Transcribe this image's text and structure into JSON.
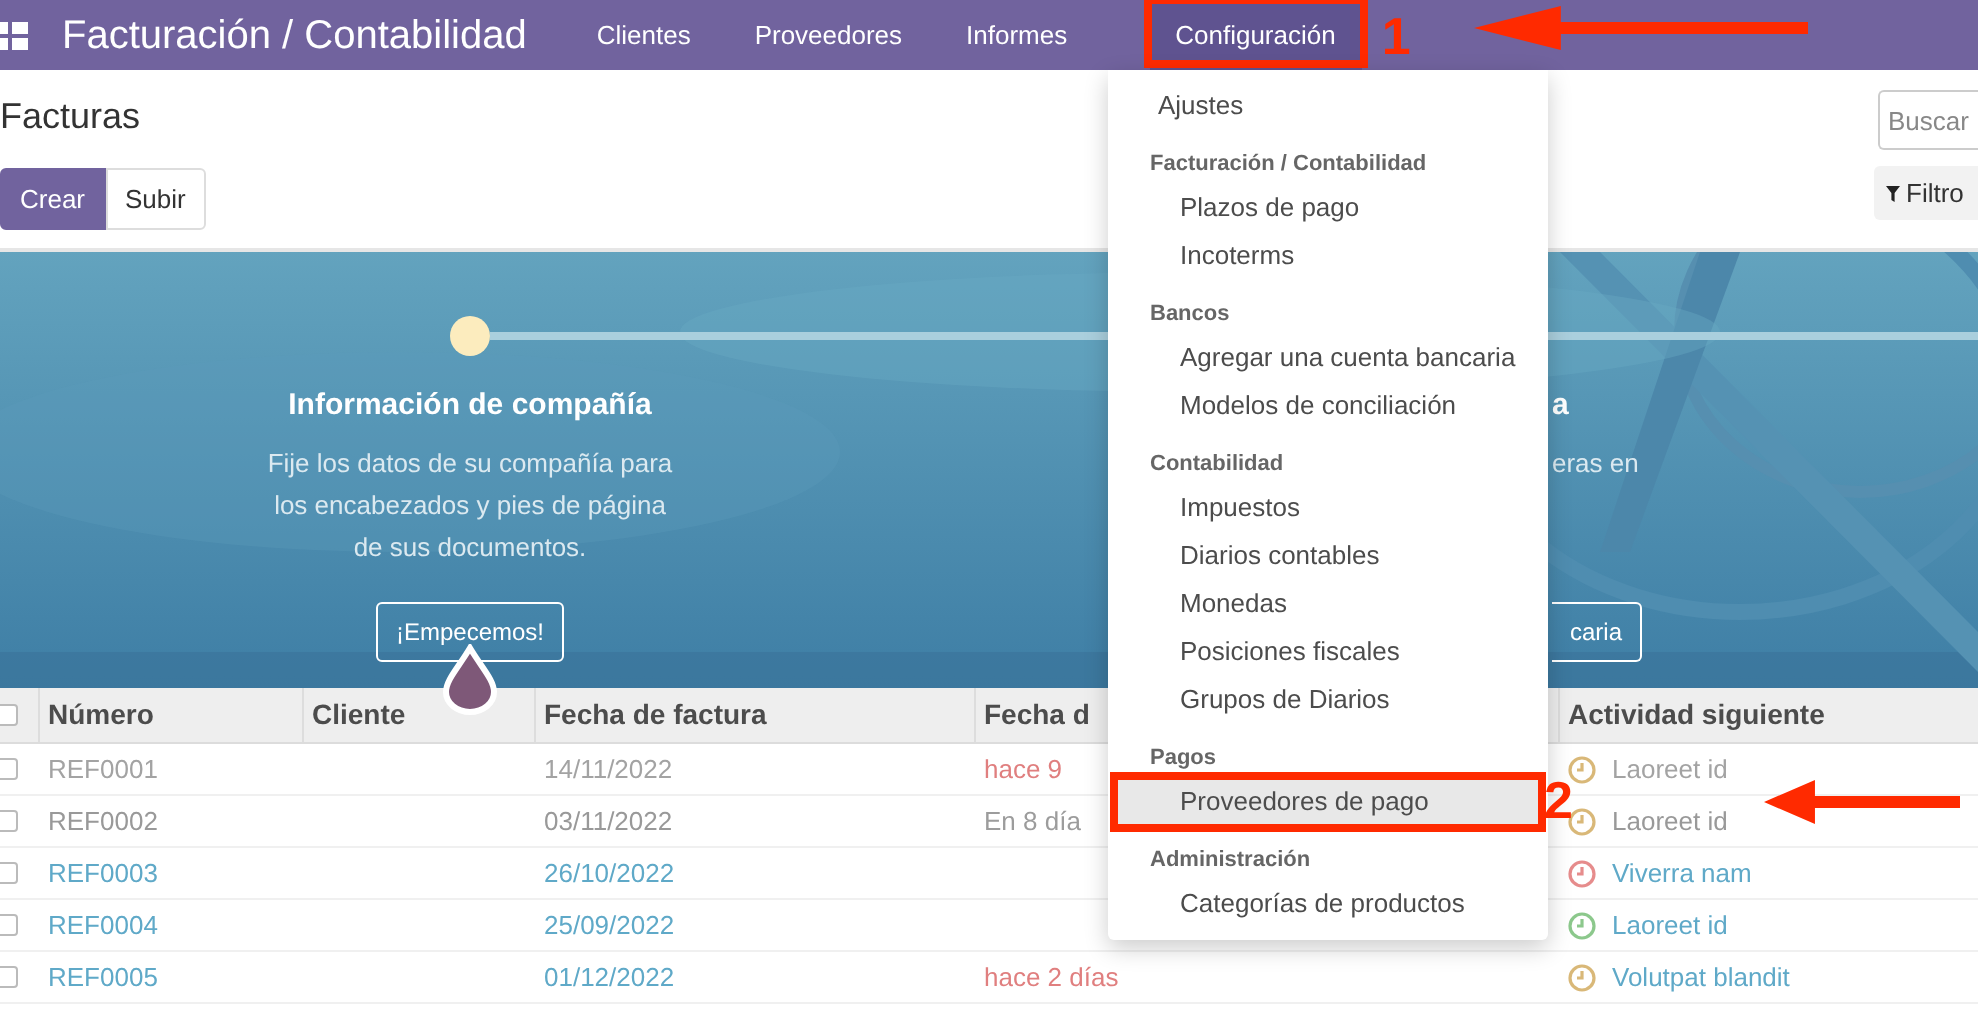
{
  "app": {
    "title": "Facturación / Contabilidad"
  },
  "nav": [
    {
      "label": "Clientes",
      "selected": false
    },
    {
      "label": "Proveedores",
      "selected": false
    },
    {
      "label": "Informes",
      "selected": false
    },
    {
      "label": "Configuración",
      "selected": true,
      "annotation": "1"
    }
  ],
  "page_title": "Facturas",
  "buttons": [
    {
      "label": "Crear",
      "kind": "primary"
    },
    {
      "label": "Subir",
      "kind": "secondary"
    }
  ],
  "search": {
    "placeholder": "Buscar"
  },
  "filter_button": {
    "label": "Filtro"
  },
  "onboarding": {
    "steps": [
      {
        "kind": "full",
        "title": "Información de compañía",
        "description_lines": [
          "Fije los datos de su compañía para",
          "los encabezados y pies de página",
          "de sus documentos."
        ],
        "button": "¡Empecemos!"
      },
      {
        "kind": "partial",
        "title": "a",
        "description_lines": [
          "eras en"
        ],
        "button": "caria"
      }
    ]
  },
  "menu": {
    "items": [
      {
        "kind": "item",
        "label": "Ajustes",
        "selected": false
      },
      {
        "kind": "header",
        "label": "Facturación / Contabilidad"
      },
      {
        "kind": "subitem",
        "label": "Plazos de pago",
        "selected": false
      },
      {
        "kind": "subitem",
        "label": "Incoterms",
        "selected": false
      },
      {
        "kind": "header",
        "label": "Bancos"
      },
      {
        "kind": "subitem",
        "label": "Agregar una cuenta bancaria",
        "selected": false
      },
      {
        "kind": "subitem",
        "label": "Modelos de conciliación",
        "selected": false
      },
      {
        "kind": "header",
        "label": "Contabilidad"
      },
      {
        "kind": "subitem",
        "label": "Impuestos",
        "selected": false
      },
      {
        "kind": "subitem",
        "label": "Diarios contables",
        "selected": false
      },
      {
        "kind": "subitem",
        "label": "Monedas",
        "selected": false
      },
      {
        "kind": "subitem",
        "label": "Posiciones fiscales",
        "selected": false
      },
      {
        "kind": "subitem",
        "label": "Grupos de Diarios",
        "selected": false
      },
      {
        "kind": "header",
        "label": "Pagos"
      },
      {
        "kind": "subitem",
        "label": "Proveedores de pago",
        "selected": true,
        "annotation": "2"
      },
      {
        "kind": "header",
        "label": "Administración"
      },
      {
        "kind": "subitem",
        "label": "Categorías de productos",
        "selected": false
      }
    ]
  },
  "table": {
    "select_all_checked": false,
    "columns": [
      "Número",
      "Cliente",
      "Fecha de factura",
      "Fecha d",
      "Actividad siguiente"
    ],
    "rows": [
      {
        "checked": false,
        "number": "REF0001",
        "date": "14/11/2022",
        "color": "#a3a3a3",
        "due": {
          "text": "hace 9",
          "color": "#e07f7f"
        },
        "activity": {
          "text": "Laoreet id",
          "color": "#d9b878"
        }
      },
      {
        "checked": false,
        "number": "REF0002",
        "date": "03/11/2022",
        "color": "#999999",
        "due": {
          "text": "En 8 día",
          "color": "#9c9c9c"
        },
        "activity": {
          "text": "Laoreet id",
          "color": "#d9b878"
        }
      },
      {
        "checked": false,
        "number": "REF0003",
        "date": "26/10/2022",
        "color": "#5fa9c8",
        "activity": {
          "text": "Viverra nam",
          "color": "#e68c8c"
        }
      },
      {
        "checked": false,
        "number": "REF0004",
        "date": "25/09/2022",
        "color": "#5fa9c8",
        "activity": {
          "text": "Laoreet id",
          "color": "#8cc88c"
        }
      },
      {
        "checked": false,
        "number": "REF0005",
        "date": "01/12/2022",
        "color": "#5fa9c8",
        "due": {
          "text": "hace 2 días",
          "color": "#e07f7f"
        },
        "activity": {
          "text": "Volutpat blandit",
          "color": "#d9b878"
        }
      }
    ]
  }
}
